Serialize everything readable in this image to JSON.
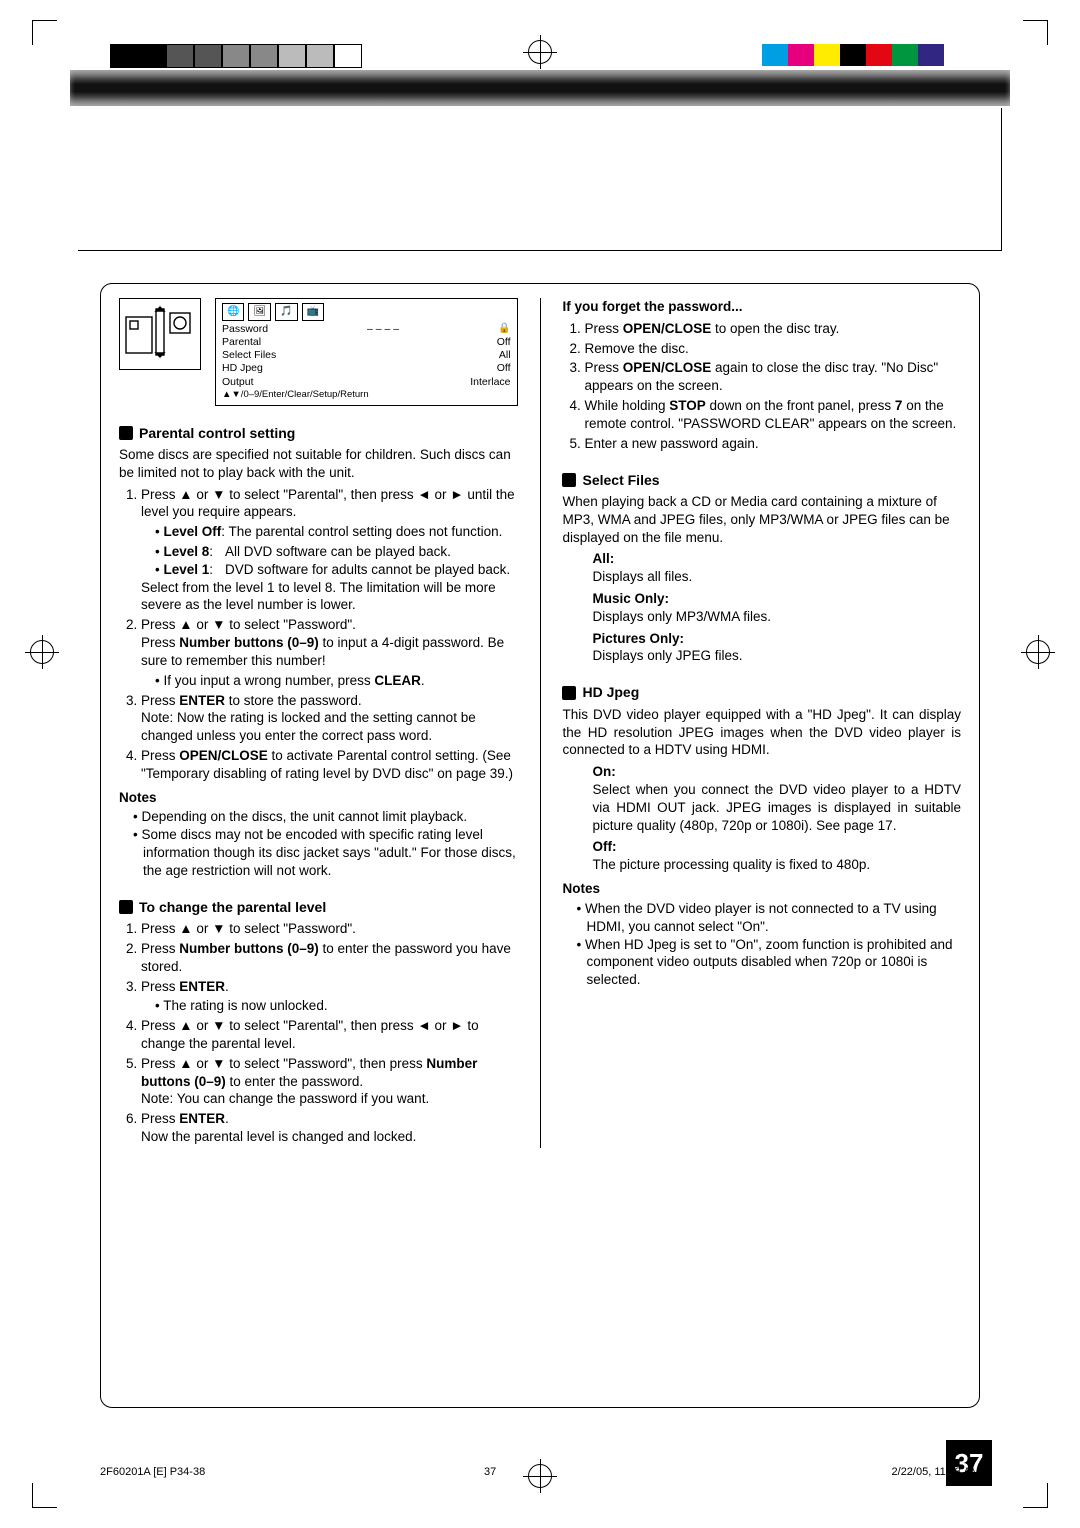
{
  "osd": {
    "rows": [
      {
        "label": "Password",
        "value": "– – – –"
      },
      {
        "label": "Parental",
        "value": "Off"
      },
      {
        "label": "Select Files",
        "value": "All"
      },
      {
        "label": "HD Jpeg",
        "value": "Off"
      },
      {
        "label": "Output",
        "value": "Interlace"
      }
    ],
    "hint": "▲▼/0–9/Enter/Clear/Setup/Return"
  },
  "secA": {
    "title": "Parental control setting",
    "intro": "Some discs are specified not suitable for children. Such discs can be limited not to play back with the unit.",
    "step1_lead": "Press ▲ or ▼ to select \"Parental\", then press ◄ or ► until the level you require appears.",
    "level_off_lbl": "Level Off",
    "level_off_txt": ": The parental control setting does not function.",
    "level8_lbl": "Level 8",
    "level8_txt": "All DVD software can be played back.",
    "level1_lbl": "Level 1",
    "level1_txt": "DVD software for adults cannot be played back.",
    "step1_tail": "Select from the level 1 to level 8. The limitation will be more severe as the level number is lower.",
    "step2_a": "Press ▲ or ▼ to select \"Password\".",
    "step2_b_pre": "Press ",
    "step2_b_bold": "Number buttons (0–9)",
    "step2_b_post": " to input a 4-digit password. Be sure to remember this number!",
    "step2_c": "If you input a wrong number, press ",
    "step2_c_bold": "CLEAR",
    "step2_c_end": ".",
    "step3_pre": "Press ",
    "step3_bold": "ENTER",
    "step3_post": " to store the password.",
    "step3_note": "Note: Now the rating is locked and the setting cannot be changed unless you enter the correct pass word.",
    "step4_pre": "Press ",
    "step4_bold": "OPEN/CLOSE",
    "step4_post": " to activate Parental control setting. (See \"Temporary disabling of rating level by DVD disc\" on page 39.)",
    "notes_title": "Notes",
    "note1": "Depending on the discs, the unit cannot limit playback.",
    "note2": "Some discs may not be encoded with specific rating level information though its disc jacket says \"adult.\" For those discs, the age restriction will not work."
  },
  "secB": {
    "title": "To change the parental level",
    "s1": "Press ▲ or ▼ to select \"Password\".",
    "s2_pre": "Press ",
    "s2_bold": "Number buttons (0–9)",
    "s2_post": " to enter the password you have stored.",
    "s3_pre": "Press ",
    "s3_bold": "ENTER",
    "s3_post": ".",
    "s3_sub": "The rating is now unlocked.",
    "s4": "Press ▲ or ▼ to select \"Parental\", then press ◄ or ► to change the parental level.",
    "s5_a": "Press ▲ or ▼ to select \"Password\", then press ",
    "s5_bold": "Number buttons (0–9)",
    "s5_b": " to enter the password.",
    "s5_note": "Note: You can change the password if you want.",
    "s6_pre": "Press ",
    "s6_bold": "ENTER",
    "s6_post": ".",
    "s6_sub": "Now the parental level is changed and locked."
  },
  "secC": {
    "title": "If you forget the password...",
    "s1_pre": "Press ",
    "s1_bold": "OPEN/CLOSE",
    "s1_post": " to open the disc tray.",
    "s2": "Remove the disc.",
    "s3_pre": "Press ",
    "s3_bold": "OPEN/CLOSE",
    "s3_post": " again to close the disc tray. \"No Disc\" appears on the screen.",
    "s4_a": "While holding ",
    "s4_bold1": "STOP",
    "s4_b": " down on the front panel, press ",
    "s4_bold2": "7",
    "s4_c": " on the remote control. \"PASSWORD CLEAR\" appears on the screen.",
    "s5": "Enter a new password again."
  },
  "secD": {
    "title": "Select Files",
    "intro": "When playing back a CD or Media card containing a mixture of MP3, WMA and JPEG files, only MP3/WMA or JPEG files can be displayed on the file menu.",
    "all_lbl": "All:",
    "all_txt": "Displays all files.",
    "music_lbl": "Music Only:",
    "music_txt": "Displays only MP3/WMA files.",
    "pic_lbl": "Pictures Only:",
    "pic_txt": "Displays only JPEG files."
  },
  "secE": {
    "title": "HD Jpeg",
    "intro": "This DVD video player equipped with a \"HD Jpeg\". It can display the HD resolution JPEG images when the DVD video player is connected to a HDTV using HDMI.",
    "on_lbl": "On:",
    "on_txt": "Select when you connect the DVD video player to a HDTV via HDMI OUT jack. JPEG images is displayed in suitable picture quality (480p, 720p or 1080i). See page 17.",
    "off_lbl": "Off:",
    "off_txt": "The picture processing quality is fixed to 480p.",
    "notes_title": "Notes",
    "note1": "When the DVD video player is not connected to a TV using HDMI, you cannot select \"On\".",
    "note2": "When HD Jpeg is set to \"On\", zoom function is prohibited and component video outputs disabled when 720p or 1080i is selected."
  },
  "page_number": "37",
  "footer": {
    "left": "2F60201A [E] P34-38",
    "mid": "37",
    "right": "2/22/05, 11:13 AM"
  },
  "colorbars": {
    "left": [
      "#000",
      "#000",
      "#555",
      "#555",
      "#888",
      "#888",
      "#bbb",
      "#bbb",
      "#fff"
    ],
    "right": [
      "#009fe3",
      "#e6007e",
      "#ffec00",
      "#000",
      "#e30613",
      "#009640",
      "#312783",
      "#fff"
    ]
  }
}
